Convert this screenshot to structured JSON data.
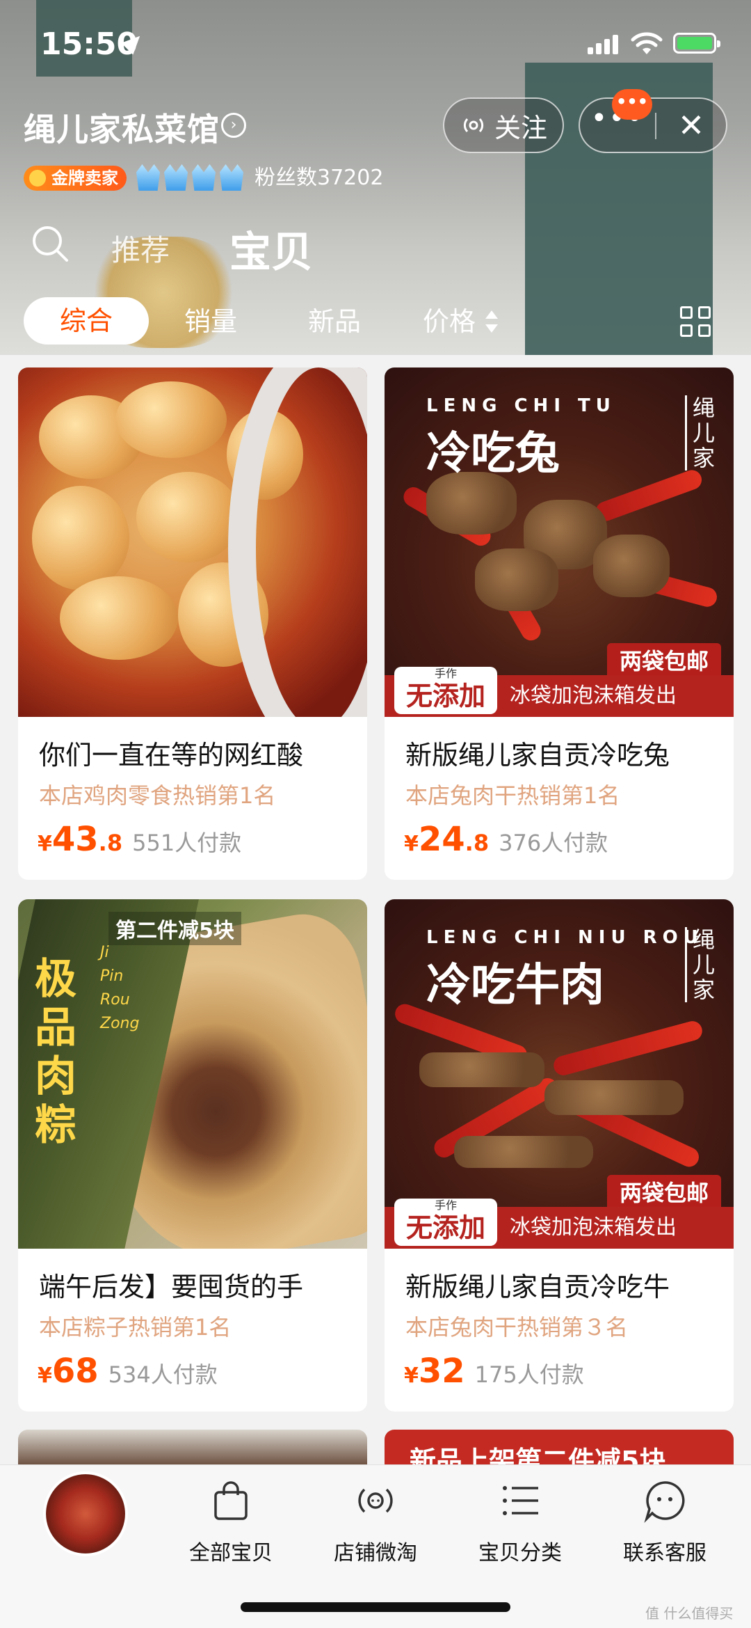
{
  "status_bar": {
    "time": "15:50"
  },
  "shop": {
    "name": "绳儿家私菜馆",
    "follow_label": "关注",
    "more_label": "•••",
    "notify_badge": "•••",
    "gold_badge": "金牌卖家",
    "fans": "粉丝数37202"
  },
  "tabs": {
    "recommend": "推荐",
    "items": "宝贝"
  },
  "filters": {
    "overall": "综合",
    "sales": "销量",
    "new": "新品",
    "price": "价格"
  },
  "products": [
    {
      "title": "你们一直在等的网红酸",
      "rank": "本店鸡肉零食热销第1名",
      "yen": "¥",
      "price_int": "43",
      "price_dec": ".8",
      "sold": "551人付款"
    },
    {
      "title": "新版绳儿家自贡冷吃兔",
      "rank": "本店兔肉干热销第1名",
      "yen": "¥",
      "price_int": "24",
      "price_dec": ".8",
      "sold": "376人付款",
      "image_text": {
        "pinyin": "LENG CHI TU",
        "big": "冷吃兔",
        "brand": "绳儿家",
        "tag_two": "两袋包邮",
        "noadd_small": "手作",
        "noadd": "无添加",
        "ship": "冰袋加泡沫箱发出"
      }
    },
    {
      "title": "端午后发】要囤货的手",
      "rank": "本店粽子热销第1名",
      "yen": "¥",
      "price_int": "68",
      "price_dec": "",
      "sold": "534人付款",
      "image_text": {
        "banner": "第二件减5块",
        "vertical": "极品肉粽",
        "pinyin": "Ji Pin Rou Zong"
      }
    },
    {
      "title": "新版绳儿家自贡冷吃牛",
      "rank": "本店兔肉干热销第３名",
      "yen": "¥",
      "price_int": "32",
      "price_dec": "",
      "sold": "175人付款",
      "image_text": {
        "pinyin": "LENG CHI NIU ROU",
        "big": "冷吃牛肉",
        "brand": "绳儿家",
        "tag_two": "两袋包邮",
        "noadd_small": "手作",
        "noadd": "无添加",
        "ship": "冰袋加泡沫箱发出"
      }
    }
  ],
  "peek_banner": "新品上架第二件减5块",
  "bottom_nav": [
    {
      "label": "全部宝贝",
      "icon": "bag-icon"
    },
    {
      "label": "店铺微淘",
      "icon": "broadcast-icon"
    },
    {
      "label": "宝贝分类",
      "icon": "list-icon"
    },
    {
      "label": "联系客服",
      "icon": "chat-bubble-icon"
    }
  ],
  "watermark": "值 什么值得买",
  "colors": {
    "accent": "#ff5000",
    "rank_text": "#e0a47f",
    "gold_badge": "#ff6a1a"
  }
}
